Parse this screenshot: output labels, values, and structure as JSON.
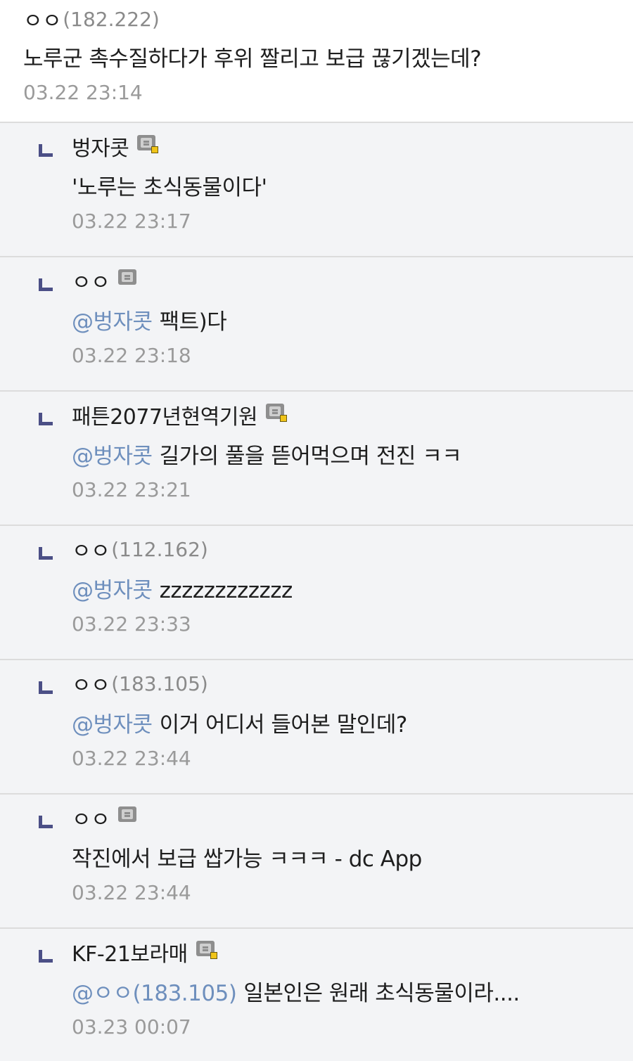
{
  "comments": [
    {
      "nick": "ㅇㅇ",
      "ip": "(182.222)",
      "has_gallog_icon": false,
      "mention": "",
      "text": "노루군 촉수질하다가 후위 짤리고 보급 끊기겠는데?",
      "date": "03.22 23:14"
    }
  ],
  "replies": [
    {
      "nick": "벙자콧",
      "ip": "",
      "gallog_icon": "fixed-nick-gallog-icon",
      "mention": "",
      "text": "'노루는 초식동물이다'",
      "date": "03.22 23:17"
    },
    {
      "nick": "ㅇㅇ",
      "ip": "",
      "gallog_icon": "half-fixed-nick-gallog-icon",
      "mention": "@벙자콧",
      "text": "팩트)다",
      "date": "03.22 23:18"
    },
    {
      "nick": "패튼2077년현역기원",
      "ip": "",
      "gallog_icon": "fixed-nick-gallog-icon",
      "mention": "@벙자콧",
      "text": "길가의 풀을 뜯어먹으며 전진 ㅋㅋ",
      "date": "03.22 23:21"
    },
    {
      "nick": "ㅇㅇ",
      "ip": "(112.162)",
      "gallog_icon": "",
      "mention": "@벙자콧",
      "text": "zzzzzzzzzzzz",
      "date": "03.22 23:33"
    },
    {
      "nick": "ㅇㅇ",
      "ip": "(183.105)",
      "gallog_icon": "",
      "mention": "@벙자콧",
      "text": "이거 어디서 들어본 말인데?",
      "date": "03.22 23:44"
    },
    {
      "nick": "ㅇㅇ",
      "ip": "",
      "gallog_icon": "half-fixed-nick-gallog-icon",
      "mention": "",
      "text": "작진에서 보급 쌉가능 ㅋㅋㅋ - dc App",
      "date": "03.22 23:44"
    },
    {
      "nick": "KF-21보라매",
      "ip": "",
      "gallog_icon": "fixed-nick-gallog-icon",
      "mention": "@ㅇㅇ(183.105)",
      "text": "일본인은 원래 초식동물이라....",
      "date": "03.23 00:07"
    }
  ],
  "colors": {
    "reply_background": "#f3f4f6",
    "mention": "#6e8fbd",
    "date": "#9a9a9a",
    "reply_marker": "#4b4f86",
    "gallog_dot": "#f0c419"
  }
}
